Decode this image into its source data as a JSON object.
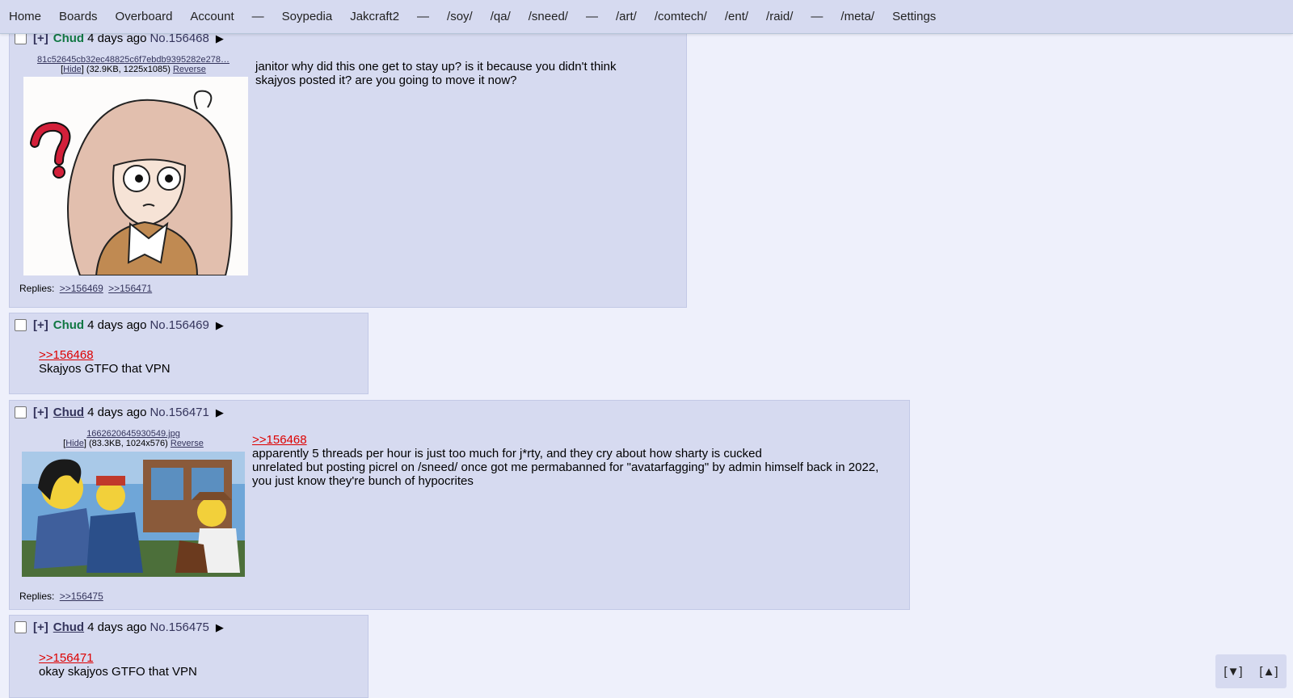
{
  "nav": {
    "items": [
      "Home",
      "Boards",
      "Overboard",
      "Account",
      "—",
      "Soypedia",
      "Jakcraft2",
      "—",
      "/soy/",
      "/qa/",
      "/sneed/",
      "—",
      "/art/",
      "/comtech/",
      "/ent/",
      "/raid/",
      "—",
      "/meta/",
      "Settings"
    ]
  },
  "posts": [
    {
      "expand": "[+]",
      "name": "Chud",
      "date": "4 days ago",
      "no": "No.156468",
      "arrow": "▶",
      "file": {
        "name": "81c52645cb32ec48825c6f7ebdb9395282e278…",
        "hide": "Hide",
        "meta": "(32.9KB, 1225x1085)",
        "reverse": "Reverse"
      },
      "lines": [
        "janitor why did this one get to stay up? is it because you didn't think",
        "skajyos posted it? are you going to move it now?"
      ],
      "replies_label": "Replies:",
      "replies": [
        ">>156469",
        ">>156471"
      ]
    },
    {
      "expand": "[+]",
      "name": "Chud",
      "date": "4 days ago",
      "no": "No.156469",
      "arrow": "▶",
      "quote": ">>156468",
      "lines": [
        "Skajyos GTFO that VPN"
      ]
    },
    {
      "expand": "[+]",
      "name": "Chud",
      "date": "4 days ago",
      "no": "No.156471",
      "arrow": "▶",
      "file": {
        "name": "1662620645930549.jpg",
        "hide": "Hide",
        "meta": "(83.3KB, 1024x576)",
        "reverse": "Reverse"
      },
      "quote": ">>156468",
      "lines": [
        "apparently 5 threads per hour is just too much for j*rty, and they cry about how sharty is cucked",
        "unrelated but posting picrel on /sneed/ once got me permabanned for \"avatarfagging\" by admin himself back in 2022,",
        "you just know they're bunch of hypocrites"
      ],
      "replies_label": "Replies:",
      "replies": [
        ">>156475"
      ]
    },
    {
      "expand": "[+]",
      "name": "Chud",
      "date": "4 days ago",
      "no": "No.156475",
      "arrow": "▶",
      "quote": ">>156471",
      "lines": [
        "okay skajyos GTFO that VPN"
      ]
    }
  ],
  "scroll": {
    "down": "[▼]",
    "up": "[▲]"
  }
}
